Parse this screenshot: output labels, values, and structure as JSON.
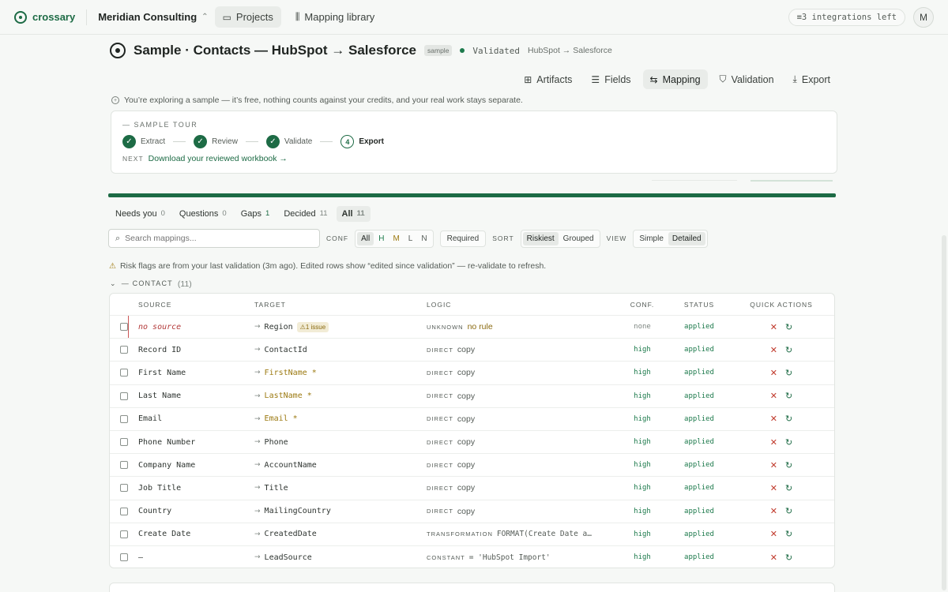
{
  "app": {
    "name": "crossary"
  },
  "nav": {
    "org": "Meridian Consulting",
    "tabs": [
      {
        "label": "Projects"
      },
      {
        "label": "Mapping library"
      }
    ],
    "integrations": "≡3 integrations left",
    "avatar": "M"
  },
  "project": {
    "title": "Sample · Contacts — HubSpot → Salesforce",
    "badge": "sample",
    "status": "Validated",
    "route": "HubSpot → Salesforce"
  },
  "subtabs": [
    {
      "label": "Artifacts"
    },
    {
      "label": "Fields"
    },
    {
      "label": "Mapping"
    },
    {
      "label": "Validation"
    },
    {
      "label": "Export"
    }
  ],
  "explore_note": "You’re exploring a sample — it’s free, nothing counts against your credits, and your real work stays separate.",
  "tour": {
    "label": "— SAMPLE TOUR",
    "steps": [
      {
        "label": "Extract"
      },
      {
        "label": "Review"
      },
      {
        "label": "Validate"
      },
      {
        "label": "Export",
        "num": "4"
      }
    ],
    "next_label": "NEXT",
    "next_link": "Download your reviewed workbook →"
  },
  "progress": 1.0,
  "filters": [
    {
      "label": "Needs you",
      "count": "0"
    },
    {
      "label": "Questions",
      "count": "0"
    },
    {
      "label": "Gaps",
      "count": "1"
    },
    {
      "label": "Decided",
      "count": "11"
    },
    {
      "label": "All",
      "count": "11"
    }
  ],
  "toolbar": {
    "search_placeholder": "Search mappings...",
    "conf_label": "CONF",
    "conf_options": [
      "All",
      "H",
      "M",
      "L",
      "N"
    ],
    "required": "Required",
    "sort_label": "SORT",
    "sort_options": [
      "Riskiest",
      "Grouped"
    ],
    "view_label": "VIEW",
    "view_options": [
      "Simple",
      "Detailed"
    ]
  },
  "risk_note": "Risk flags are from your last validation (3m ago). Edited rows show “edited since validation” — re-validate to refresh.",
  "group": {
    "label": "— CONTACT",
    "count": "(11)"
  },
  "columns": [
    "SOURCE",
    "TARGET",
    "LOGIC",
    "CONF.",
    "STATUS",
    "QUICK ACTIONS"
  ],
  "rows": [
    {
      "source": "no source",
      "target": "Region",
      "issue": "1 issue",
      "kind": "UNKNOWN",
      "rule": "no rule",
      "conf": "none",
      "status": "applied"
    },
    {
      "source": "Record ID",
      "target": "ContactId",
      "kind": "DIRECT",
      "rule": "copy",
      "conf": "high",
      "status": "applied"
    },
    {
      "source": "First Name",
      "target": "FirstName *",
      "kind": "DIRECT",
      "rule": "copy",
      "conf": "high",
      "status": "applied"
    },
    {
      "source": "Last Name",
      "target": "LastName *",
      "kind": "DIRECT",
      "rule": "copy",
      "conf": "high",
      "status": "applied"
    },
    {
      "source": "Email",
      "target": "Email *",
      "kind": "DIRECT",
      "rule": "copy",
      "conf": "high",
      "status": "applied"
    },
    {
      "source": "Phone Number",
      "target": "Phone",
      "kind": "DIRECT",
      "rule": "copy",
      "conf": "high",
      "status": "applied"
    },
    {
      "source": "Company Name",
      "target": "AccountName",
      "kind": "DIRECT",
      "rule": "copy",
      "conf": "high",
      "status": "applied"
    },
    {
      "source": "Job Title",
      "target": "Title",
      "kind": "DIRECT",
      "rule": "copy",
      "conf": "high",
      "status": "applied"
    },
    {
      "source": "Country",
      "target": "MailingCountry",
      "kind": "DIRECT",
      "rule": "copy",
      "conf": "high",
      "status": "applied"
    },
    {
      "source": "Create Date",
      "target": "CreatedDate",
      "kind": "TRANSFORMATION",
      "rule": "FORMAT(Create Date a…",
      "conf": "high",
      "status": "applied"
    },
    {
      "source": "—",
      "target": "LeadSource",
      "kind": "CONSTANT",
      "rule": "= 'HubSpot Import'",
      "conf": "high",
      "status": "applied"
    }
  ]
}
